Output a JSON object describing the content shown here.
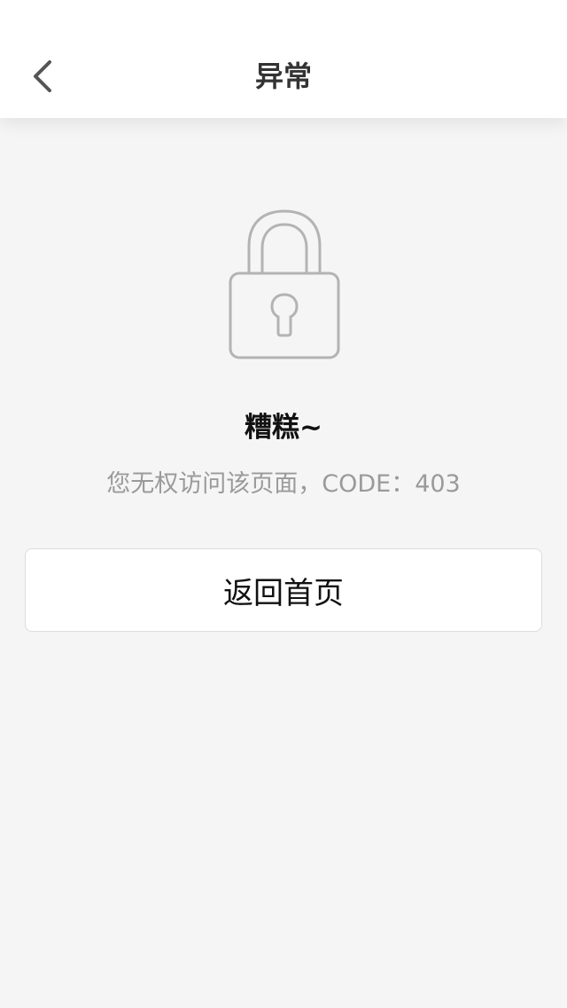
{
  "header": {
    "title": "异常",
    "back_icon": "chevron-left-icon"
  },
  "error": {
    "icon": "lock-icon",
    "title": "糟糕~",
    "message": "您无权访问该页面，CODE：403"
  },
  "actions": {
    "home_label": "返回首页"
  },
  "colors": {
    "page_background": "#f5f5f5",
    "header_background": "#ffffff",
    "title_text": "#333333",
    "message_text": "#9a9a9a",
    "icon_stroke": "#b3b3b3"
  }
}
